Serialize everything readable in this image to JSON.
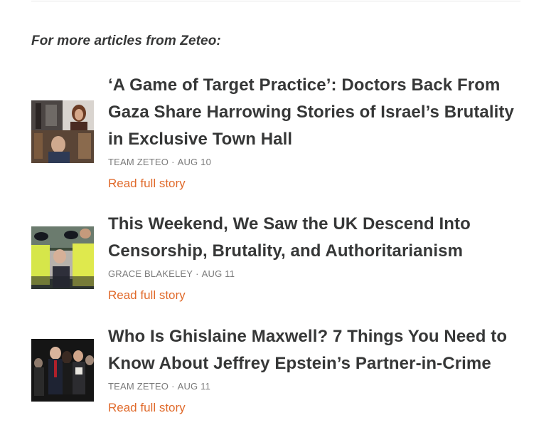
{
  "intro": "For more articles from Zeteo:",
  "articles": [
    {
      "title": "‘A Game of Target Practice’: Doctors Back From Gaza Share Harrowing Stories of Israel’s Brutality in Exclusive Town Hall",
      "author": "TEAM ZETEO",
      "separator": "·",
      "date": "AUG 10",
      "link": "Read full story"
    },
    {
      "title": "This Weekend, We Saw the UK Descend Into Censorship, Brutality, and Authoritarianism",
      "author": "GRACE BLAKELEY",
      "separator": "·",
      "date": "AUG 11",
      "link": "Read full story"
    },
    {
      "title": "Who Is Ghislaine Maxwell? 7 Things You Need to Know About Jeffrey Epstein’s Partner-in-Crime",
      "author": "TEAM ZETEO",
      "separator": "·",
      "date": "AUG 11",
      "link": "Read full story"
    }
  ],
  "colors": {
    "text": "#363737",
    "meta": "#7a7a7a",
    "link": "#e06a2b"
  }
}
